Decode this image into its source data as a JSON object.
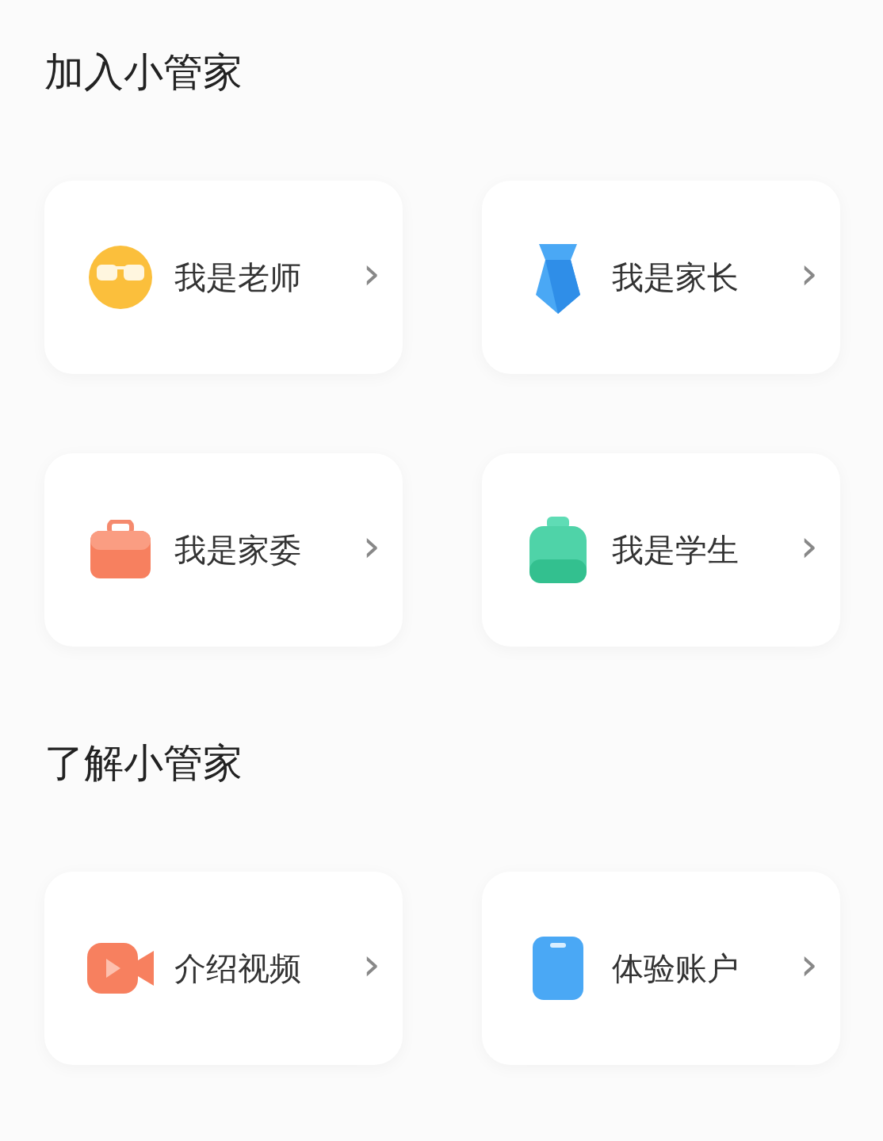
{
  "sections": [
    {
      "title": "加入小管家",
      "items": [
        {
          "kind": "sunglasses",
          "label": "我是老师",
          "chevron": "›"
        },
        {
          "kind": "tie",
          "label": "我是家长",
          "chevron": "›"
        },
        {
          "kind": "briefcase",
          "label": "我是家委",
          "chevron": "›"
        },
        {
          "kind": "bag",
          "label": "我是学生",
          "chevron": "›"
        }
      ]
    },
    {
      "title": "了解小管家",
      "items": [
        {
          "kind": "video",
          "label": "介绍视频",
          "chevron": "›"
        },
        {
          "kind": "phone",
          "label": "体验账户",
          "chevron": "›"
        }
      ]
    }
  ]
}
